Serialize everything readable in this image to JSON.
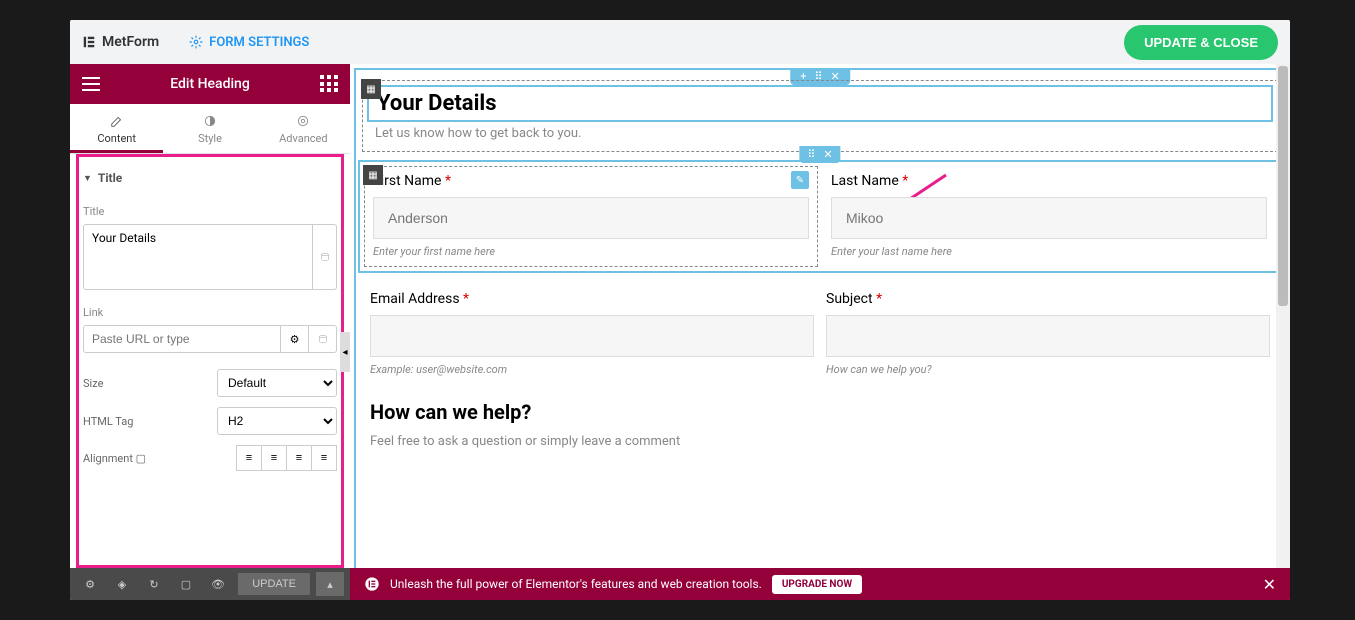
{
  "topbar": {
    "logo": "MetForm",
    "form_settings": "FORM SETTINGS",
    "update_close": "UPDATE & CLOSE"
  },
  "sidebar": {
    "title": "Edit Heading",
    "tabs": {
      "content": "Content",
      "style": "Style",
      "advanced": "Advanced"
    },
    "section": "Title",
    "fields": {
      "title_label": "Title",
      "title_value": "Your Details",
      "link_label": "Link",
      "link_placeholder": "Paste URL or type",
      "size_label": "Size",
      "size_value": "Default",
      "html_tag_label": "HTML Tag",
      "html_tag_value": "H2",
      "alignment_label": "Alignment"
    }
  },
  "bottombar": {
    "update": "UPDATE"
  },
  "banner": {
    "text": "Unleash the full power of Elementor's features and web creation tools.",
    "upgrade": "UPGRADE NOW"
  },
  "canvas": {
    "heading": {
      "title": "Your Details",
      "subtitle": "Let us know how to get back to you."
    },
    "first_name": {
      "label": "First Name",
      "placeholder": "Anderson",
      "helper": "Enter your first name here"
    },
    "last_name": {
      "label": "Last Name",
      "placeholder": "Mikoo",
      "helper": "Enter your last name here"
    },
    "email": {
      "label": "Email Address",
      "helper": "Example: user@website.com"
    },
    "subject": {
      "label": "Subject",
      "helper": "How can we help you?"
    },
    "help": {
      "title": "How can we help?",
      "subtitle": "Feel free to ask a question or simply leave a comment"
    }
  }
}
